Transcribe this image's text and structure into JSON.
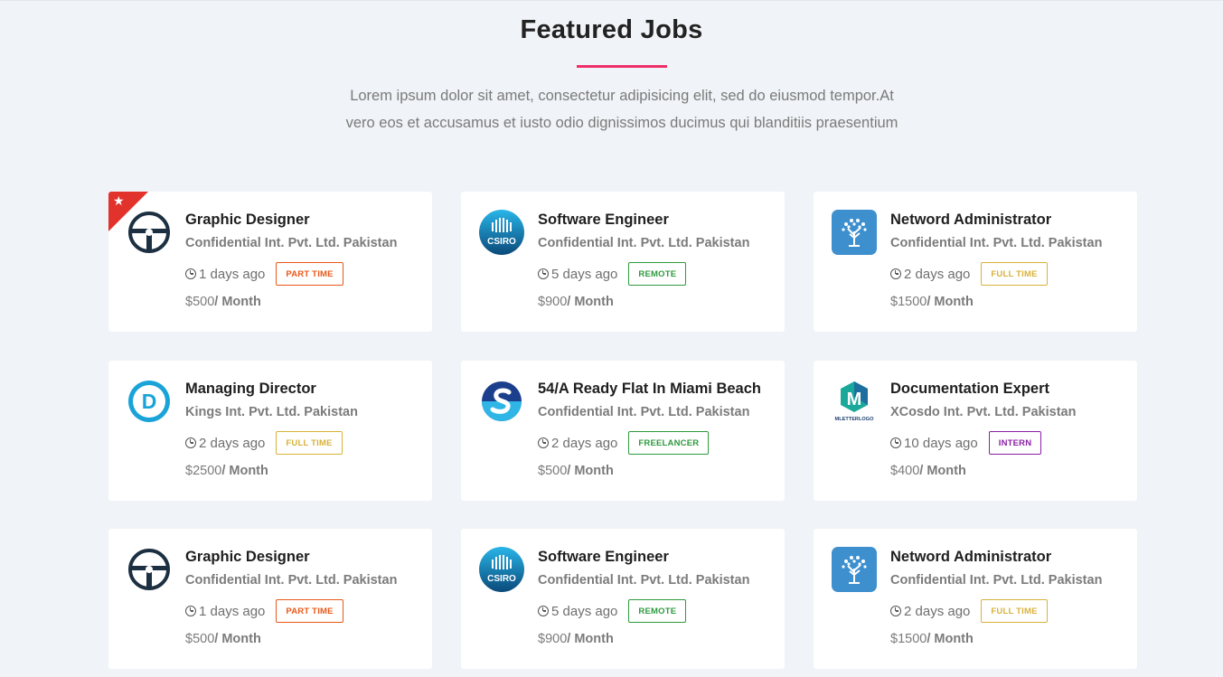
{
  "section": {
    "title": "Featured Jobs",
    "description_line1": "Lorem ipsum dolor sit amet, consectetur adipisicing elit, sed do eiusmod tempor.At",
    "description_line2": "vero eos et accusamus et iusto odio dignissimos ducimus qui blanditiis praesentium",
    "accent_color": "#ef2f6a"
  },
  "jobs": [
    {
      "title": "Graphic Designer",
      "company": "Confidential Int. Pvt. Ltd. Pakistan",
      "posted": "1 days ago",
      "type": "PART TIME",
      "type_color": "#e8591a",
      "salary": "$500",
      "period": "/ Month",
      "logo": "steering-logo",
      "featured": true
    },
    {
      "title": "Software Engineer",
      "company": "Confidential Int. Pvt. Ltd. Pakistan",
      "posted": "5 days ago",
      "type": "REMOTE",
      "type_color": "#2e9a3e",
      "salary": "$900",
      "period": "/ Month",
      "logo": "csiro-logo",
      "logo_text": "CSIRO"
    },
    {
      "title": "Netword Administrator",
      "company": "Confidential Int. Pvt. Ltd. Pakistan",
      "posted": "2 days ago",
      "type": "FULL TIME",
      "type_color": "#d8b23a",
      "salary": "$1500",
      "period": "/ Month",
      "logo": "tree-logo"
    },
    {
      "title": "Managing Director",
      "company": "Kings Int. Pvt. Ltd. Pakistan",
      "posted": "2 days ago",
      "type": "FULL TIME",
      "type_color": "#d8b23a",
      "salary": "$2500",
      "period": "/ Month",
      "logo": "d-circle-logo",
      "logo_text": "D"
    },
    {
      "title": "54/A Ready Flat In Miami Beach",
      "company": "Confidential Int. Pvt. Ltd. Pakistan",
      "posted": "2 days ago",
      "type": "FREELANCER",
      "type_color": "#2e9a3e",
      "salary": "$500",
      "period": "/ Month",
      "logo": "s-circle-logo"
    },
    {
      "title": "Documentation Expert",
      "company": "XCosdo Int. Pvt. Ltd. Pakistan",
      "posted": "10 days ago",
      "type": "INTERN",
      "type_color": "#8a1fa6",
      "salary": "$400",
      "period": "/ Month",
      "logo": "m-hexagon-logo",
      "logo_text": "MLETTERLOGO"
    },
    {
      "title": "Graphic Designer",
      "company": "Confidential Int. Pvt. Ltd. Pakistan",
      "posted": "1 days ago",
      "type": "PART TIME",
      "type_color": "#e8591a",
      "salary": "$500",
      "period": "/ Month",
      "logo": "steering-logo"
    },
    {
      "title": "Software Engineer",
      "company": "Confidential Int. Pvt. Ltd. Pakistan",
      "posted": "5 days ago",
      "type": "REMOTE",
      "type_color": "#2e9a3e",
      "salary": "$900",
      "period": "/ Month",
      "logo": "csiro-logo",
      "logo_text": "CSIRO"
    },
    {
      "title": "Netword Administrator",
      "company": "Confidential Int. Pvt. Ltd. Pakistan",
      "posted": "2 days ago",
      "type": "FULL TIME",
      "type_color": "#d8b23a",
      "salary": "$1500",
      "period": "/ Month",
      "logo": "tree-logo"
    }
  ]
}
